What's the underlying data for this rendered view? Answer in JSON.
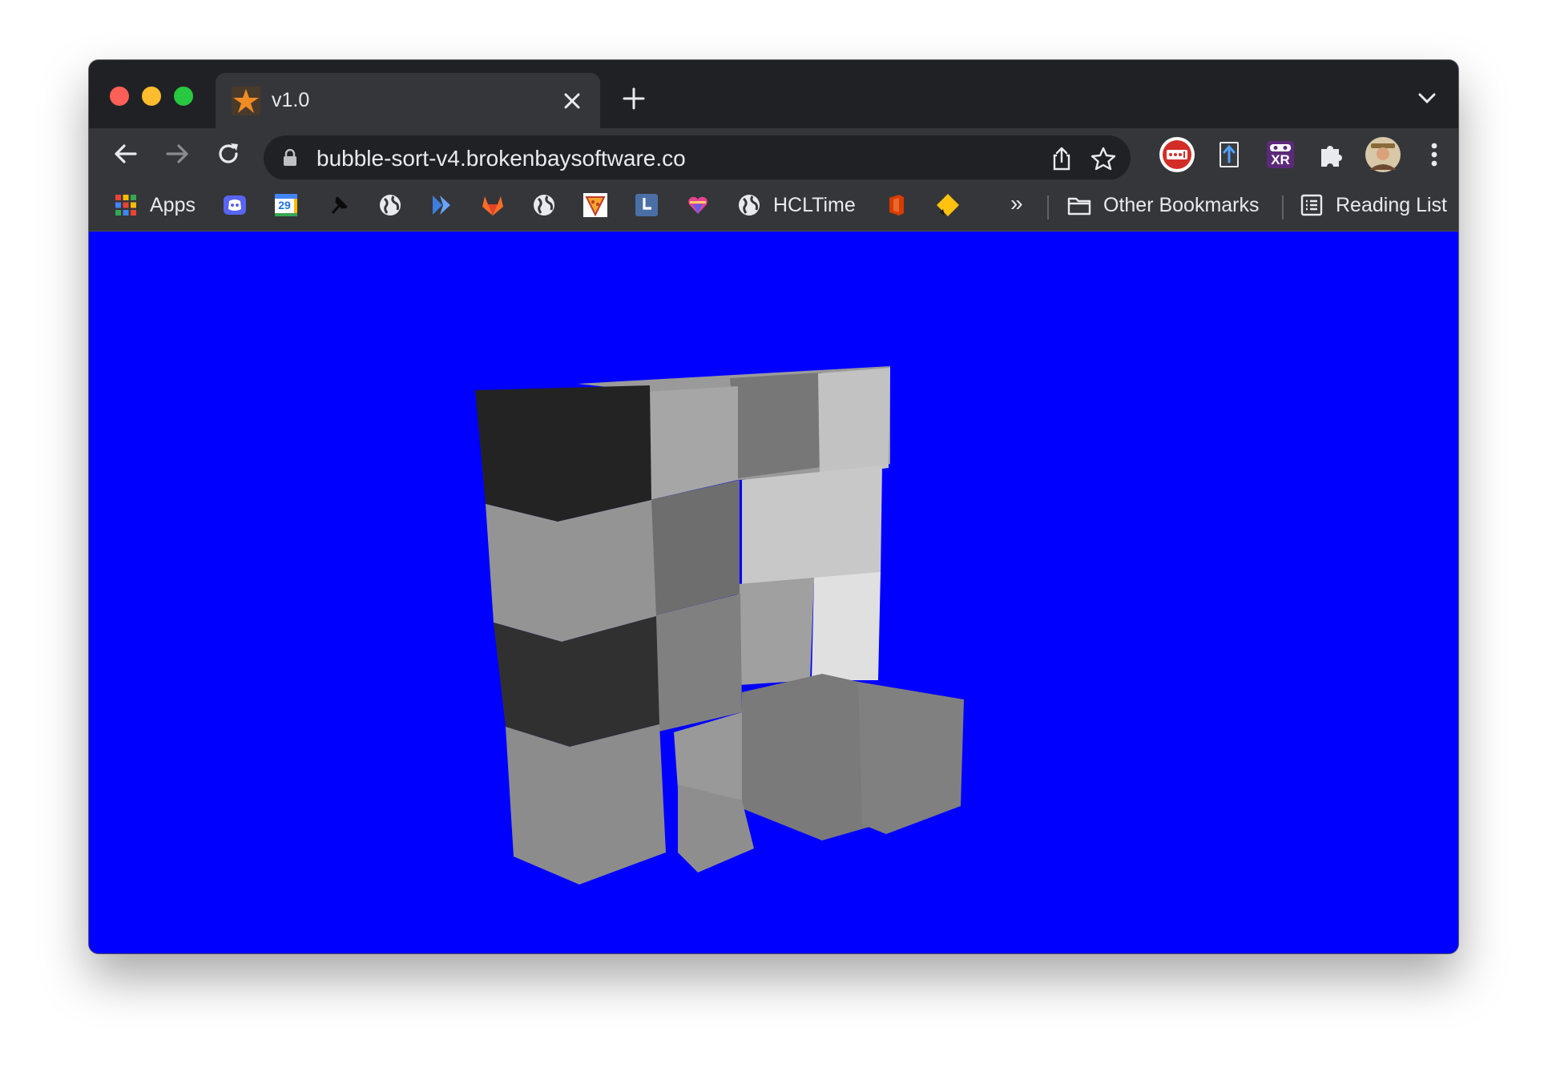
{
  "tab": {
    "title": "v1.0"
  },
  "address_bar": {
    "url": "bubble-sort-v4.brokenbaysoftware.co"
  },
  "bookmarks": {
    "apps_label": "Apps",
    "hcltime_label": "HCLTime",
    "other_label": "Other Bookmarks",
    "reading_label": "Reading List",
    "overflow": "»",
    "calendar_day": "29"
  },
  "extensions": {
    "xr_label": "XR"
  },
  "colors": {
    "background": "#0000ff",
    "chrome_dark": "#202124",
    "chrome_toolbar": "#35363a"
  }
}
